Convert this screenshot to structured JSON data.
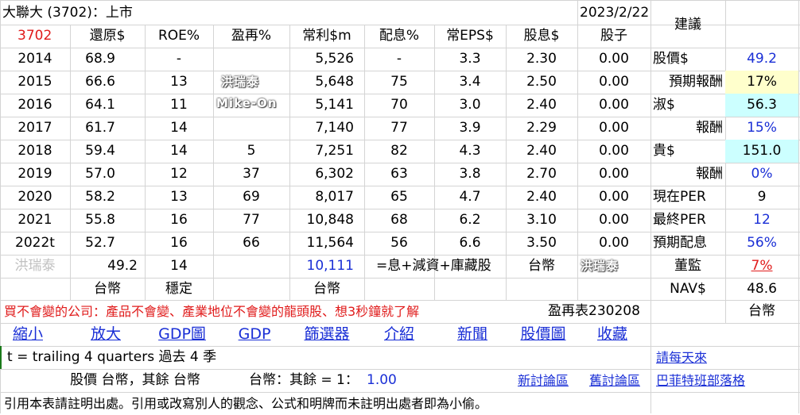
{
  "header": {
    "company": "大聯大 (3702)：上市",
    "date": "2023/2/22",
    "suggestion_label": "建議"
  },
  "columns": [
    "3702",
    "還原$",
    "ROE%",
    "盈再%",
    "常利$m",
    "配息%",
    "常EPS$",
    "股息$",
    "股子"
  ],
  "rows": [
    {
      "year": "2014",
      "restored": "68.9",
      "roe": "-",
      "reinvest": "",
      "profit": "5,526",
      "payout": "-",
      "eps": "3.3",
      "dividend": "2.30",
      "stock_div": "0.00"
    },
    {
      "year": "2015",
      "restored": "66.6",
      "roe": "13",
      "reinvest": "",
      "profit": "5,648",
      "payout": "75",
      "eps": "3.4",
      "dividend": "2.50",
      "stock_div": "0.00"
    },
    {
      "year": "2016",
      "restored": "64.1",
      "roe": "11",
      "reinvest": "",
      "profit": "5,141",
      "payout": "70",
      "eps": "3.0",
      "dividend": "2.40",
      "stock_div": "0.00"
    },
    {
      "year": "2017",
      "restored": "61.7",
      "roe": "14",
      "reinvest": "",
      "profit": "7,140",
      "payout": "77",
      "eps": "3.9",
      "dividend": "2.29",
      "stock_div": "0.00"
    },
    {
      "year": "2018",
      "restored": "59.4",
      "roe": "14",
      "reinvest": "5",
      "profit": "7,251",
      "payout": "82",
      "eps": "4.3",
      "dividend": "2.40",
      "stock_div": "0.00"
    },
    {
      "year": "2019",
      "restored": "57.0",
      "roe": "12",
      "reinvest": "37",
      "profit": "6,302",
      "payout": "63",
      "eps": "3.8",
      "dividend": "2.70",
      "stock_div": "0.00"
    },
    {
      "year": "2020",
      "restored": "58.2",
      "roe": "13",
      "reinvest": "69",
      "profit": "8,017",
      "payout": "65",
      "eps": "4.7",
      "dividend": "2.40",
      "stock_div": "0.00"
    },
    {
      "year": "2021",
      "restored": "55.8",
      "roe": "16",
      "reinvest": "77",
      "profit": "10,848",
      "payout": "68",
      "eps": "6.2",
      "dividend": "3.10",
      "stock_div": "0.00"
    },
    {
      "year": "2022t",
      "restored": "52.7",
      "roe": "16",
      "reinvest": "66",
      "profit": "11,564",
      "payout": "56",
      "eps": "6.6",
      "dividend": "3.50",
      "stock_div": "0.00"
    }
  ],
  "summary": {
    "author": "洪瑞泰",
    "restored": "49.2",
    "roe": "14",
    "profit": "10,111",
    "profit_note": "=息+減資+庫藏股",
    "currency1": "台幣",
    "currency2": "台幣",
    "stable": "穩定",
    "currency3": "台幣"
  },
  "side": [
    {
      "label": "股價$",
      "value": "49.2"
    },
    {
      "label": "預期報酬",
      "value": "17%"
    },
    {
      "label": "淑$",
      "value": "56.3"
    },
    {
      "label": "報酬",
      "value": "15%"
    },
    {
      "label": "貴$",
      "value": "151.0"
    },
    {
      "label": "報酬",
      "value": "0%"
    },
    {
      "label": "現在PER",
      "value": "9"
    },
    {
      "label": "最終PER",
      "value": "12"
    },
    {
      "label": "預期配息",
      "value": "56%"
    },
    {
      "label": "董監",
      "value": "7%"
    },
    {
      "label": "NAV$",
      "value": "48.6"
    },
    {
      "label": "",
      "value": "台幣"
    }
  ],
  "watermarks": {
    "name": "洪瑞泰",
    "brand": "Mike-On"
  },
  "banner": "買不會變的公司：產品不會變、產業地位不會變的龍頭股、想3秒鐘就了解",
  "table_version": "盈再表230208",
  "nav_links": [
    "縮小",
    "放大",
    "GDP圖",
    "GDP",
    "篩選器",
    "介紹",
    "新聞",
    "股價圖",
    "收藏"
  ],
  "daily_link": "請每天來",
  "trailing_note": "t = trailing 4 quarters 過去 4 季",
  "currency_line": "股價 台幣，其餘 台幣",
  "fx_label": "台幣：其餘 = 1：",
  "fx_value": "1.00",
  "forum_links": [
    "新討論區",
    "舊討論區",
    "巴菲特班部落格"
  ],
  "footer": "引用本表請註明出處。引用或改寫別人的觀念、公式和明牌而未註明出處者即為小偷。",
  "colors": {
    "red": "#e01b1b",
    "blue": "#1a2fd6",
    "yellow_fill": "#ffffcc",
    "cyan_fill": "#ccffff"
  }
}
